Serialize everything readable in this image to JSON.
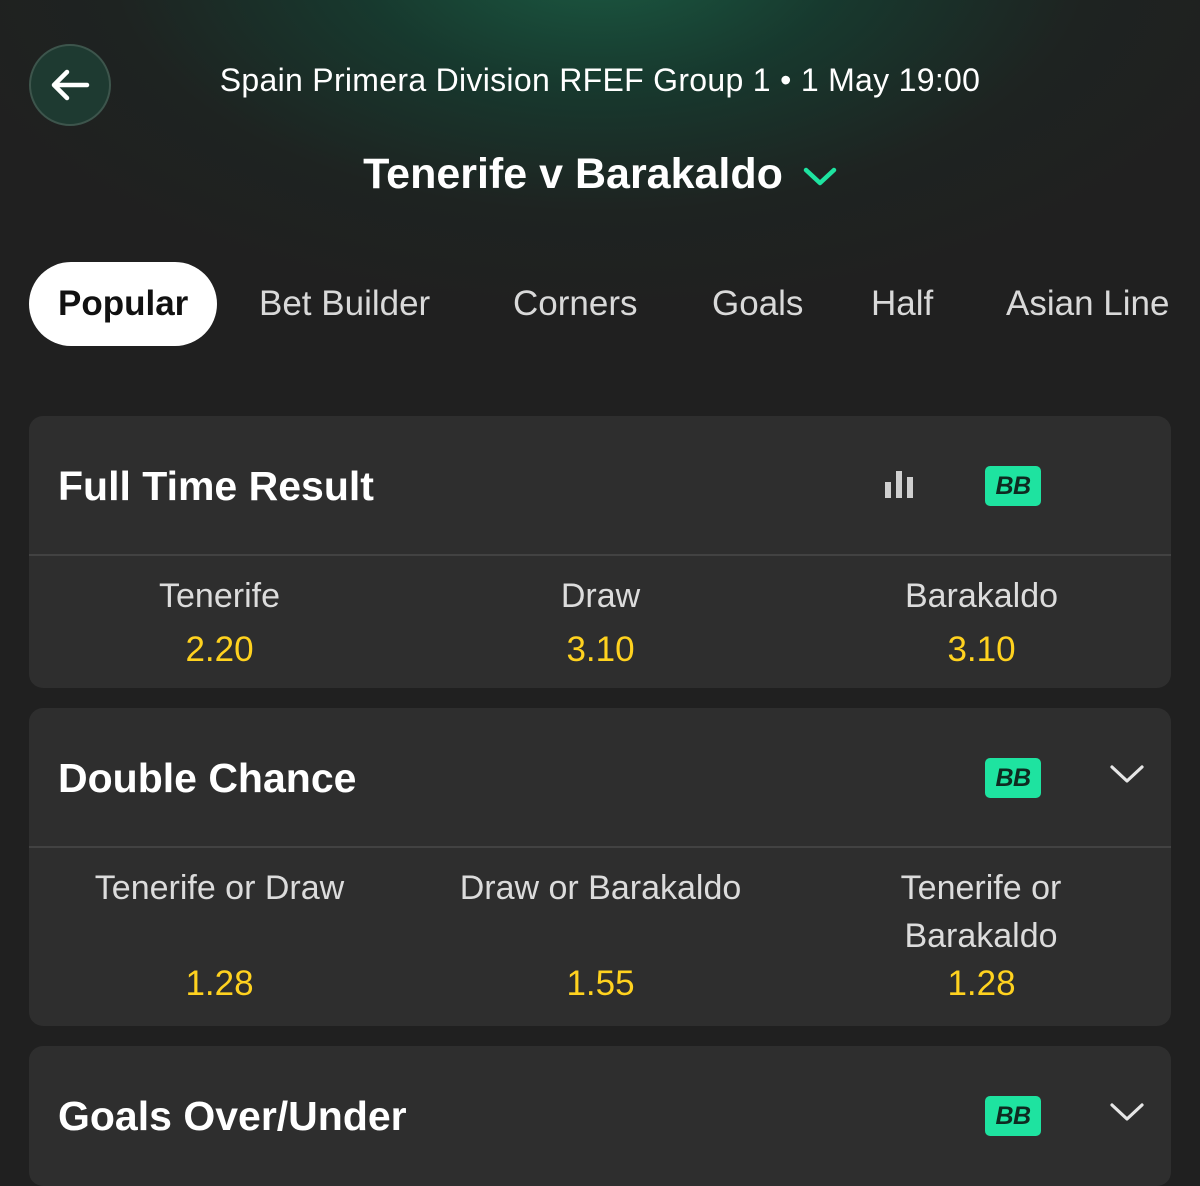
{
  "header": {
    "competition": "Spain Primera Division RFEF Group 1",
    "separator": "•",
    "kickoff": "1 May 19:00",
    "match_title": "Tenerife v Barakaldo"
  },
  "tabs": [
    "Popular",
    "Bet Builder",
    "Corners",
    "Goals",
    "Half",
    "Asian Line"
  ],
  "active_tab": "Popular",
  "markets": [
    {
      "title": "Full Time Result",
      "badge": "BB",
      "outcomes": [
        {
          "label": "Tenerife",
          "odds": "2.20"
        },
        {
          "label": "Draw",
          "odds": "3.10"
        },
        {
          "label": "Barakaldo",
          "odds": "3.10"
        }
      ]
    },
    {
      "title": "Double Chance",
      "badge": "BB",
      "outcomes": [
        {
          "label": "Tenerife or Draw",
          "odds": "1.28"
        },
        {
          "label": "Draw or Barakaldo",
          "odds": "1.55"
        },
        {
          "label": "Tenerife or Barakaldo",
          "odds": "1.28"
        }
      ]
    },
    {
      "title": "Goals Over/Under",
      "badge": "BB",
      "outcomes": []
    }
  ],
  "colors": {
    "accent": "#1ee3a0",
    "odds": "#ffd21f",
    "card": "#2e2e2e",
    "background": "#202020"
  },
  "icons": [
    "back-arrow-icon",
    "chevron-down-icon",
    "stats-bars-icon",
    "bet-builder-badge"
  ]
}
